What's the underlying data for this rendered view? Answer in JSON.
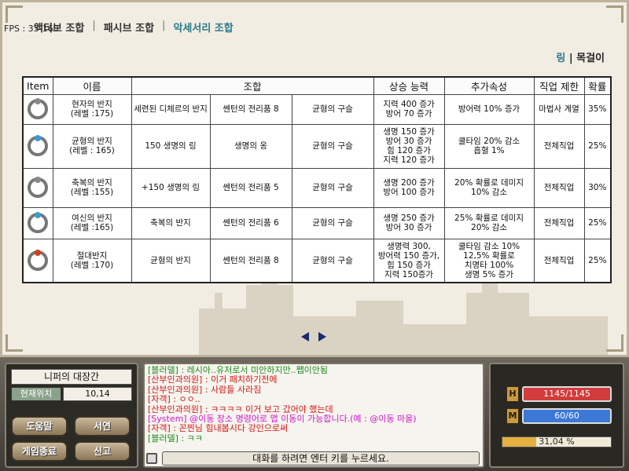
{
  "fps": "FPS : 33-160",
  "tabs": [
    {
      "label": "액티브 조합"
    },
    {
      "label": "패시브 조합"
    },
    {
      "label": "악세서리 조합"
    }
  ],
  "subtabs": {
    "ring": "링",
    "necklace": "목걸이"
  },
  "table": {
    "headers": [
      "Item",
      "이름",
      "조합",
      "상승 능력",
      "추가속성",
      "직업 제한",
      "확률"
    ],
    "rows": [
      {
        "icon": "sage-ring-icon",
        "name1": "현자의 반지",
        "name2": "(레벨 :175)",
        "m1": "세련된 디체르의 반지",
        "m2": "쎈턴의 전리품 8",
        "m3": "균형의 구슬",
        "stats": [
          "지력 400 증가",
          "방어 70 증가"
        ],
        "extra": [
          "방어력 10% 증가"
        ],
        "job": "마법사 계열",
        "prob": "35%"
      },
      {
        "icon": "balance-ring-icon",
        "name1": "균형의 반지",
        "name2": "(레벨 : 165)",
        "m1": "150 생명의 링",
        "m2": "생명의 옹",
        "m3": "균형의 구슬",
        "stats": [
          "생명 150 증가",
          "방어 30 증가",
          "힘 120 증가",
          "지력 120 증가"
        ],
        "extra": [
          "쿨타임 20% 감소",
          "흡혈 1%"
        ],
        "job": "전체직업",
        "prob": "25%"
      },
      {
        "icon": "blessing-ring-icon",
        "name1": "축복의 반지",
        "name2": "(레벨 :155)",
        "m1": "+150 생명의 링",
        "m2": "쎈턴의 전리품 5",
        "m3": "균형의 구슬",
        "stats": [
          "생명 200 증가",
          "방어 100 증가"
        ],
        "extra": [
          "20% 확률로 데미지",
          "10% 감소"
        ],
        "job": "전체직업",
        "prob": "30%"
      },
      {
        "icon": "goddess-ring-icon",
        "name1": "여신의 반지",
        "name2": "(레벨 :165)",
        "m1": "축복의 반지",
        "m2": "쎈턴의 전리품 6",
        "m3": "균형의 구슬",
        "stats": [
          "생명 250 증가",
          "방어 30 증가"
        ],
        "extra": [
          "25% 확률로 데미지",
          "20% 감소"
        ],
        "job": "전체직업",
        "prob": "25%"
      },
      {
        "icon": "absolute-ring-icon",
        "name1": "절대반지",
        "name2": "(레벨 :170)",
        "m1": "균형의 반지",
        "m2": "쎈턴의 전리품 8",
        "m3": "균형의 구슬",
        "stats": [
          "생명력 300,",
          "방어력 150 증가,",
          "힘 150 증가",
          "지력 150증가"
        ],
        "extra": [
          "쿨타임 감소 10%",
          "12,5% 확률로",
          "치명타 100%",
          "생명 5% 증가"
        ],
        "job": "전체직업",
        "prob": "25%"
      }
    ]
  },
  "location": {
    "map_name": "니퍼의 대장간",
    "pos_label": "현재위치",
    "pos_value": "10,14"
  },
  "buttons": {
    "help": "도움말",
    "book": "서연",
    "quit": "게임종료",
    "report": "신고"
  },
  "chat": [
    {
      "text": "[블러델] : 레시아..유저로서 미안하지만..쨉이안됨",
      "color": "#1e8a1e"
    },
    {
      "text": "[산부인과의원] : 이거 패치하기전에",
      "color": "#d01818"
    },
    {
      "text": "[산부인과의원] : 사람들 사라짐",
      "color": "#d01818"
    },
    {
      "text": "[자객] : ㅇㅇ..",
      "color": "#d01818"
    },
    {
      "text": "[산부인과의원] : ㅋㅋㅋㅋ 이거 보고 갔어야 했는데",
      "color": "#d01818"
    },
    {
      "text": "[System] @이동 장소 명령어로 맵 이동이 가능합니다.(예 : @이동 마을)",
      "color": "#d018c8"
    },
    {
      "text": "[자객] : 꼰찐님 힘내봅시다 강인으로써",
      "color": "#d01818"
    },
    {
      "text": "[블러델] : ㅋㅋ",
      "color": "#1e8a1e"
    }
  ],
  "chat_input_hint": "대화를 하려면 엔터 키를 누르세요.",
  "stats": {
    "hp_badge": "H",
    "hp_text": "1145/1145",
    "hp_fraction": 1.0,
    "hp_color": "#d23c3c",
    "mp_badge": "M",
    "mp_text": "60/60",
    "mp_fraction": 1.0,
    "mp_color": "#3b78d8",
    "exp_text": "31,04 %",
    "exp_fraction": 0.3104
  }
}
